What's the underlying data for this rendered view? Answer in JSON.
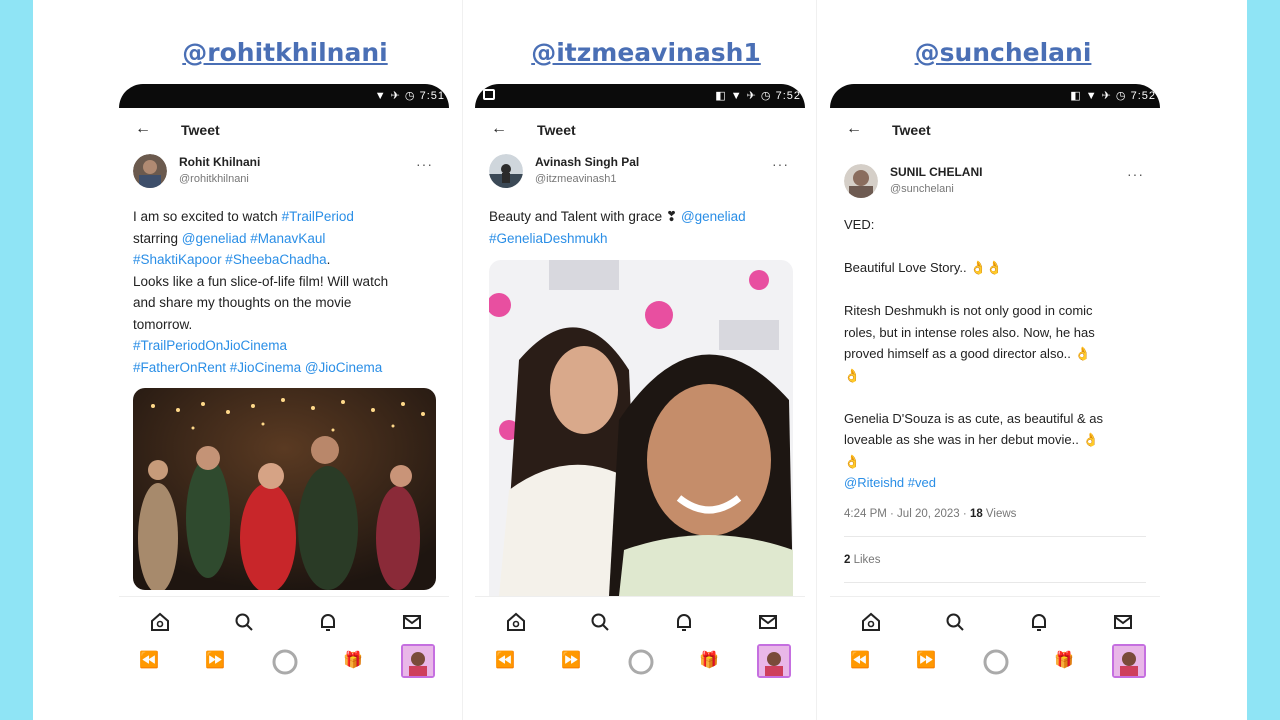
{
  "columns": [
    {
      "header": "@rohitkhilnani",
      "status_time": "7:51",
      "top_title": "Tweet",
      "author_name": "Rohit Khilnani",
      "author_handle": "@rohitkhilnani",
      "text_lines": [
        [
          {
            "t": "I am so excited to watch ",
            "link": false
          },
          {
            "t": "#TrailPeriod",
            "link": true
          }
        ],
        [
          {
            "t": "starring ",
            "link": false
          },
          {
            "t": "@geneliad #ManavKaul",
            "link": true
          }
        ],
        [
          {
            "t": "#ShaktiKapoor #SheebaChadha",
            "link": true
          },
          {
            "t": ".",
            "link": false
          }
        ],
        [
          {
            "t": "Looks like a fun slice-of-life film! Will watch",
            "link": false
          }
        ],
        [
          {
            "t": "and share my thoughts on the movie",
            "link": false
          }
        ],
        [
          {
            "t": "tomorrow.",
            "link": false
          }
        ],
        [
          {
            "t": "#TrailPeriodOnJioCinema",
            "link": true
          }
        ],
        [
          {
            "t": "#FatherOnRent #JioCinema @JioCinema",
            "link": true
          }
        ]
      ]
    },
    {
      "header": "@itzmeavinash1",
      "status_time": "7:52",
      "top_title": "Tweet",
      "author_name": "Avinash Singh Pal",
      "author_handle": "@itzmeavinash1",
      "text_lines": [
        [
          {
            "t": "Beauty and Talent with grace ",
            "link": false
          },
          {
            "t": "❣ ",
            "link": false
          },
          {
            "t": "@geneliad",
            "link": true
          }
        ],
        [
          {
            "t": "#GeneliaDeshmukh",
            "link": true
          }
        ]
      ]
    },
    {
      "header": "@sunchelani",
      "status_time": "7:52",
      "top_title": "Tweet",
      "author_name": "SUNIL CHELANI",
      "author_handle": "@sunchelani",
      "text_lines": [
        [
          {
            "t": "VED:",
            "link": false
          }
        ],
        [],
        [
          {
            "t": "Beautiful Love Story.. 👌👌",
            "link": false
          }
        ],
        [],
        [
          {
            "t": "Ritesh Deshmukh is not only good in comic",
            "link": false
          }
        ],
        [
          {
            "t": "roles, but in intense roles also. Now, he has",
            "link": false
          }
        ],
        [
          {
            "t": "proved himself as a good director also.. 👌",
            "link": false
          }
        ],
        [
          {
            "t": "👌",
            "link": false
          }
        ],
        [],
        [
          {
            "t": "Genelia D'Souza is as cute, as beautiful & as",
            "link": false
          }
        ],
        [
          {
            "t": "loveable as she was in her debut movie.. 👌",
            "link": false
          }
        ],
        [
          {
            "t": "👌",
            "link": false
          }
        ],
        [
          {
            "t": "@Riteishd #ved",
            "link": true
          }
        ]
      ],
      "meta_time": "4:24 PM · Jul 20, 2023 · ",
      "meta_views_count": "18",
      "meta_views_label": " Views",
      "likes_count": "2",
      "likes_label": " Likes"
    }
  ],
  "icons": {
    "back": "arrow-left-icon",
    "more": "more-horizontal-icon",
    "home": "home-icon",
    "search": "search-icon",
    "notifications": "bell-icon",
    "messages": "mail-icon",
    "rewind": "rewind-icon",
    "forward": "fast-forward-icon",
    "record": "circle-icon",
    "gift": "gift-icon"
  },
  "colors": {
    "background": "#8fe4f5",
    "header": "#4a6fb5",
    "link": "#2a8ee6",
    "thumb_border": "#c56fe0"
  }
}
